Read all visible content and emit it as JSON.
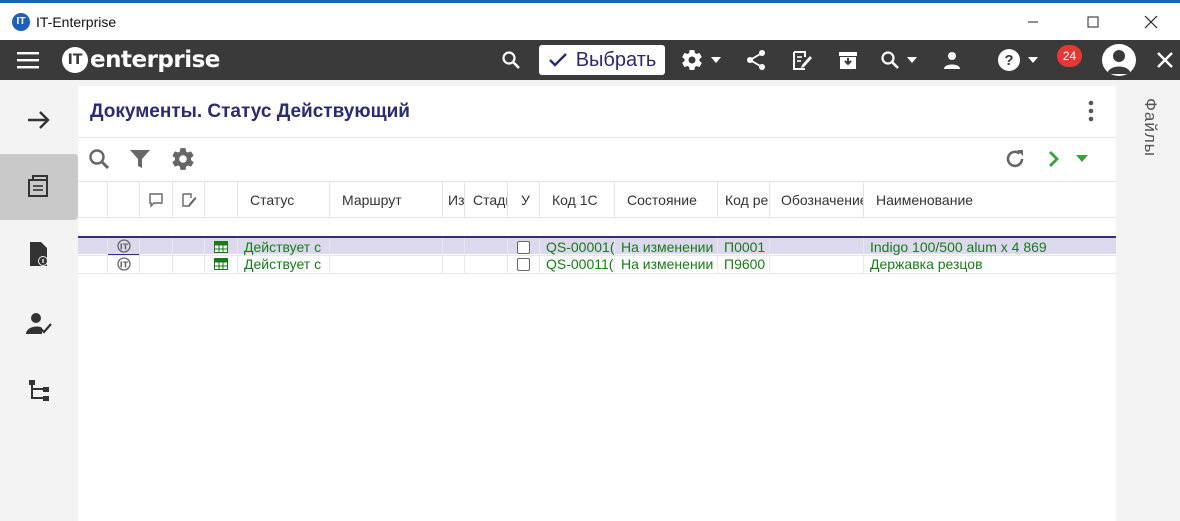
{
  "window": {
    "title": "IT-Enterprise",
    "app_icon_text": "IT"
  },
  "topbar": {
    "logo_text": "enterprise",
    "logo_mark": "IT",
    "select_label": "Выбрать",
    "notifications_count": "24",
    "icons": [
      "menu-icon",
      "search-icon",
      "check-icon",
      "gear-icon",
      "share-icon",
      "edit-icon",
      "archive-icon",
      "search-dropdown-icon",
      "person-icon",
      "help-icon",
      "account-icon",
      "close-icon"
    ]
  },
  "main": {
    "title": "Документы. Статус Действующий",
    "columns": [
      {
        "label": ""
      },
      {
        "label": ""
      },
      {
        "label": ""
      },
      {
        "label": ""
      },
      {
        "label": ""
      },
      {
        "label": "Статус"
      },
      {
        "label": "Маршрут"
      },
      {
        "label": "Из"
      },
      {
        "label": "Стади"
      },
      {
        "label": "У"
      },
      {
        "label": "Код 1С"
      },
      {
        "label": "Состояние"
      },
      {
        "label": "Код ре"
      },
      {
        "label": "Обозначение"
      },
      {
        "label": "Наименование"
      }
    ],
    "rows": [
      {
        "status": "Действует с",
        "code_1c": "QS-00001(",
        "state": "На изменении",
        "code_re": "П0001",
        "designation": "",
        "name": "Indigo 100/500 alum x 4 869",
        "selected": true
      },
      {
        "status": "Действует с",
        "code_1c": "QS-00011(",
        "state": "На изменении",
        "code_re": "П9600",
        "designation": "",
        "name": "Державка резцов",
        "selected": false
      }
    ]
  },
  "files_panel": {
    "label": "Файлы"
  },
  "colors": {
    "accent": "#2b2b6e",
    "topbar": "#3a3a3a",
    "row_text": "#1a7a1a",
    "selected_row": "#dcd8ee",
    "badge": "#e53935"
  }
}
